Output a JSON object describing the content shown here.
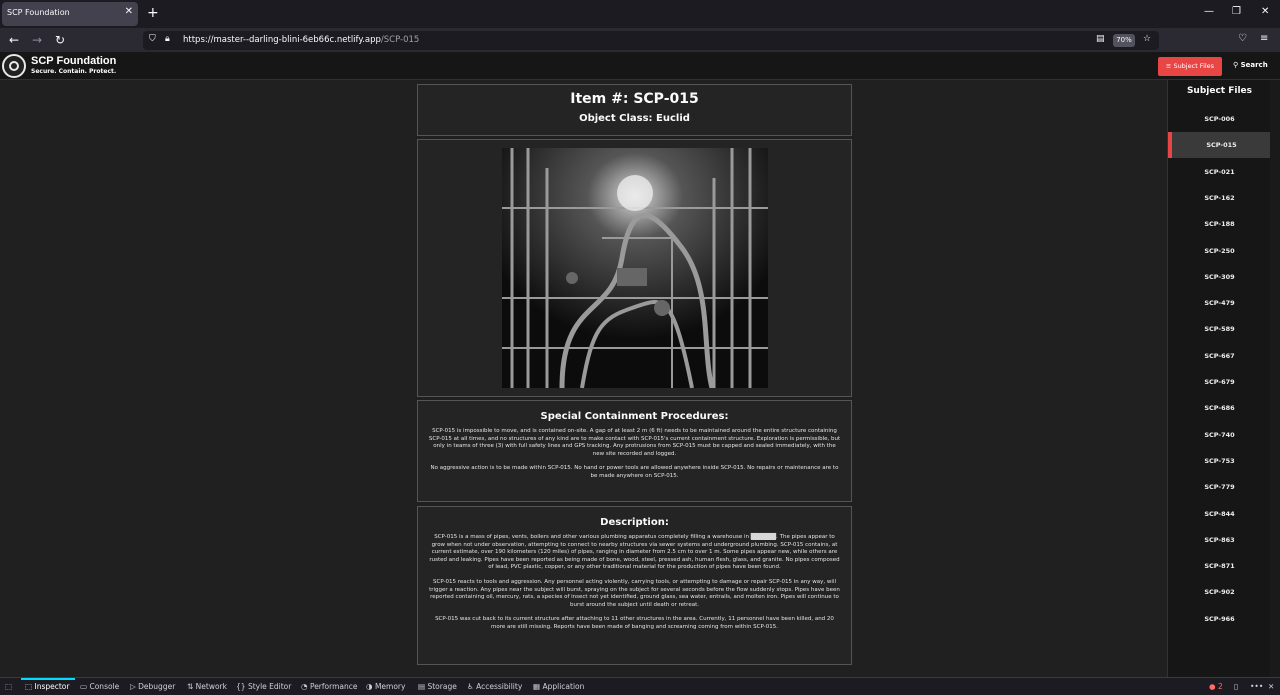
{
  "browser": {
    "tab_title": "SCP Foundation",
    "url_main": "https://master--darling-blini-6eb66c.netlify.app",
    "url_path": "/SCP-015",
    "zoom": "70%"
  },
  "site": {
    "logo_title": "SCP Foundation",
    "logo_tagline": "Secure. Contain. Protect.",
    "subject_files_button": "Subject Files",
    "search_button": "Search"
  },
  "item": {
    "title": "Item #: SCP-015",
    "object_class": "Object Class: Euclid"
  },
  "containment": {
    "heading": "Special Containment Procedures:",
    "paragraphs": [
      "SCP-015 is impossible to move, and is contained on-site. A gap of at least 2 m (6 ft) needs to be maintained around the entire structure containing SCP-015 at all times, and no structures of any kind are to make contact with SCP-015's current containment structure. Exploration is permissible, but only in teams of three (3) with full safety lines and GPS tracking. Any protrusions from SCP-015 must be capped and sealed immediately, with the new site recorded and logged.",
      "No aggressive action is to be made within SCP-015. No hand or power tools are allowed anywhere inside SCP-015. No repairs or maintenance are to be made anywhere on SCP-015."
    ]
  },
  "description": {
    "heading": "Description:",
    "p1_before": "SCP-015 is a mass of pipes, vents, boilers and other various plumbing apparatus completely filling a warehouse in ",
    "p1_redacted": "██████",
    "p1_after": ". The pipes appear to grow when not under observation, attempting to connect to nearby structures via sewer systems and underground plumbing. SCP-015 contains, at current estimate, over 190 kilometers (120 miles) of pipes, ranging in diameter from 2.5 cm to over 1 m. Some pipes appear new, while others are rusted and leaking. Pipes have been reported as being made of bone, wood, steel, pressed ash, human flesh, glass, and granite. No pipes composed of lead, PVC plastic, copper, or any other traditional material for the production of pipes have been found.",
    "p2": "SCP-015 reacts to tools and aggression. Any personnel acting violently, carrying tools, or attempting to damage or repair SCP-015 in any way, will trigger a reaction. Any pipes near the subject will burst, spraying on the subject for several seconds before the flow suddenly stops. Pipes have been reported containing oil, mercury, rats, a species of insect not yet identified, ground glass, sea water, entrails, and molten iron. Pipes will continue to burst around the subject until death or retreat.",
    "p3": "SCP-015 was cut back to its current structure after attaching to 11 other structures in the area. Currently, 11 personnel have been killed, and 20 more are still missing. Reports have been made of banging and screaming coming from within SCP-015."
  },
  "sidebar": {
    "title": "Subject Files",
    "items": [
      "SCP-006",
      "SCP-015",
      "SCP-021",
      "SCP-162",
      "SCP-188",
      "SCP-250",
      "SCP-309",
      "SCP-479",
      "SCP-589",
      "SCP-667",
      "SCP-679",
      "SCP-686",
      "SCP-740",
      "SCP-753",
      "SCP-779",
      "SCP-844",
      "SCP-863",
      "SCP-871",
      "SCP-902",
      "SCP-966"
    ],
    "active": "SCP-015"
  },
  "devtools": {
    "tabs": [
      "Inspector",
      "Console",
      "Debugger",
      "Network",
      "Style Editor",
      "Performance",
      "Memory",
      "Storage",
      "Accessibility",
      "Application"
    ],
    "error_count": "2"
  },
  "colors": {
    "accent": "#e84545",
    "bg": "#202020"
  }
}
